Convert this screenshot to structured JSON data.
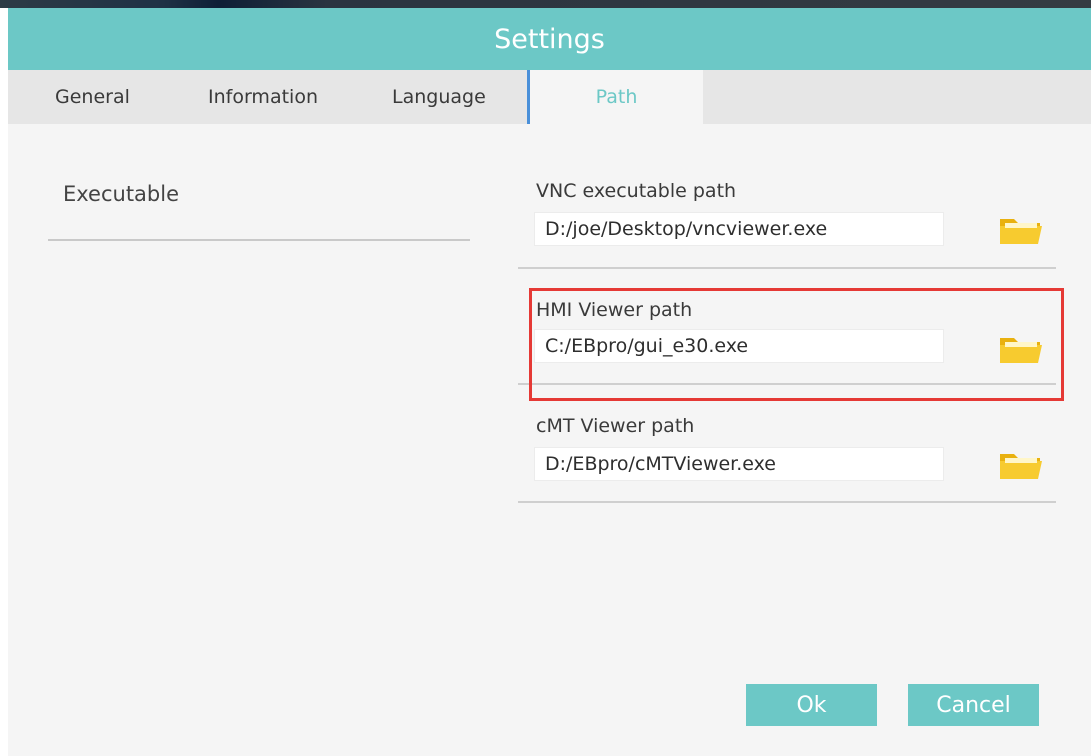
{
  "window": {
    "title": "Settings"
  },
  "tabs": [
    {
      "label": "General",
      "active": false
    },
    {
      "label": "Information",
      "active": false
    },
    {
      "label": "Language",
      "active": false
    },
    {
      "label": "Path",
      "active": true
    }
  ],
  "section": {
    "title": "Executable"
  },
  "paths": [
    {
      "label": "VNC executable path",
      "value": "D:/joe/Desktop/vncviewer.exe",
      "icon": "folder-icon"
    },
    {
      "label": "HMI Viewer path",
      "value": "C:/EBpro/gui_e30.exe",
      "icon": "folder-icon",
      "highlighted": true
    },
    {
      "label": "cMT Viewer path",
      "value": "D:/EBpro/cMTViewer.exe",
      "icon": "folder-icon"
    }
  ],
  "buttons": {
    "ok": "Ok",
    "cancel": "Cancel"
  },
  "colors": {
    "accent": "#6cc8c6",
    "highlight_border": "#e53935",
    "folder": "#f5c518",
    "active_tab_marker": "#4a90d9"
  }
}
